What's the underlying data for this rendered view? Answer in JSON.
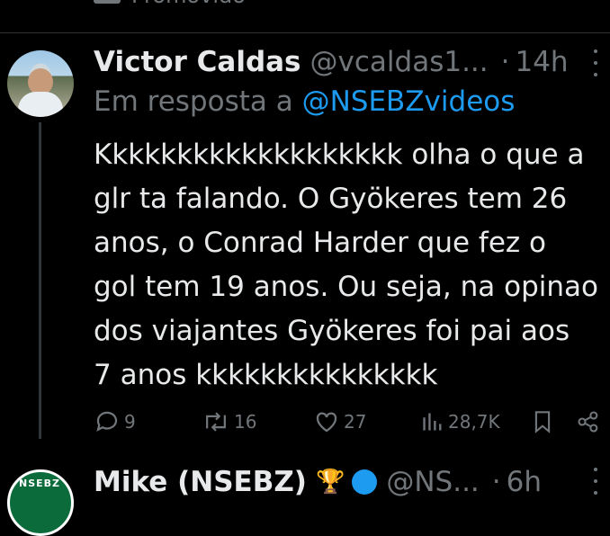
{
  "previous": {
    "label": "Promovido"
  },
  "tweet": {
    "name": "Victor Caldas",
    "handle": "@vcaldas1...",
    "dot": "·",
    "time": "14h",
    "reply_prefix": "Em resposta a",
    "reply_mention": "@NSEBZvideos",
    "text_lines": [
      "Kkkkkkkkkkkkkkkkkkk olha o que a",
      "glr ta falando. O Gyökeres tem 26",
      "anos, o Conrad Harder que fez o",
      "gol tem 19 anos. Ou seja, na opinao",
      "dos viajantes Gyökeres foi pai aos",
      "7 anos kkkkkkkkkkkkkkk"
    ],
    "replies": "9",
    "retweets": "16",
    "likes": "27",
    "views": "28,7K"
  },
  "next_tweet": {
    "avatar_text": "NSEBZ",
    "name": "Mike (NSEBZ)",
    "trophy": "🏆",
    "handle": "@NS...",
    "dot": "·",
    "time": "6h"
  },
  "colors": {
    "background": "#000000",
    "text": "#e7e9ea",
    "muted": "#71767b",
    "accent": "#1d9bf0"
  }
}
